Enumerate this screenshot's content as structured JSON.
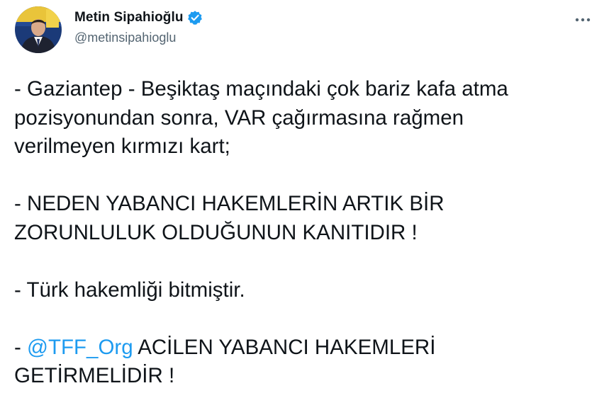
{
  "author": {
    "display_name": "Metin Sipahioğlu",
    "handle": "@metinsipahioglu",
    "verified": true
  },
  "menu": {
    "icon": "more-horizontal-icon"
  },
  "tweet": {
    "p1_line1": "- Gaziantep - Beşiktaş maçındaki çok bariz kafa atma",
    "p1_line2": "pozisyonundan sonra, VAR çağırmasına rağmen",
    "p1_line3": "verilmeyen kırmızı kart;",
    "p2_line1": "- NEDEN YABANCI HAKEMLERİN ARTIK BİR",
    "p2_line2": "ZORUNLULUK OLDUĞUNUN KANITIDIR !",
    "p3_line1": "- Türk hakemliği bitmiştir.",
    "p4_prefix": "- ",
    "p4_mention": "@TFF_Org",
    "p4_rest": " ACİLEN YABANCI HAKEMLERİ",
    "p4_line2": "GETİRMELİDİR !"
  },
  "colors": {
    "text": "#0f1419",
    "secondary": "#536471",
    "link": "#1d9bf0",
    "verified": "#1d9bf0"
  }
}
